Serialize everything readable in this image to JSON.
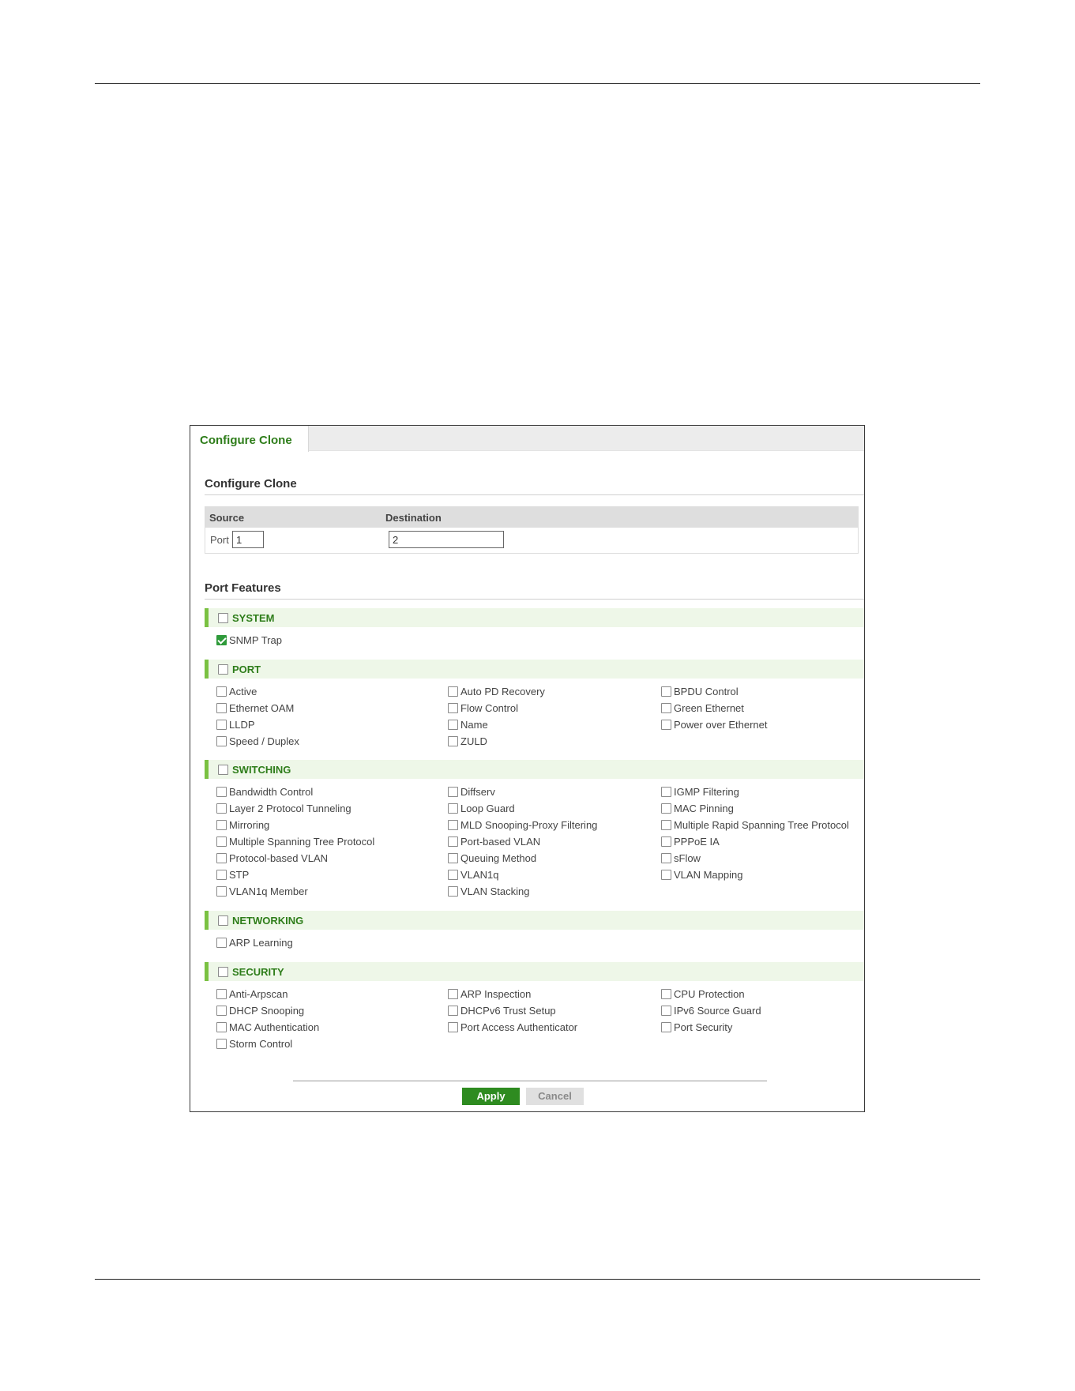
{
  "tab": {
    "label": "Configure Clone"
  },
  "section_title": "Configure Clone",
  "clone": {
    "source_header": "Source",
    "destination_header": "Destination",
    "port_label": "Port",
    "source_port": "1",
    "destination_port": "2"
  },
  "features_title": "Port Features",
  "categories": {
    "system": {
      "label": "SYSTEM",
      "checked": false,
      "items": [
        {
          "label": "SNMP Trap",
          "checked": true
        }
      ]
    },
    "port": {
      "label": "PORT",
      "checked": false,
      "items": [
        {
          "label": "Active"
        },
        {
          "label": "Auto PD Recovery"
        },
        {
          "label": "BPDU Control"
        },
        {
          "label": "Ethernet OAM"
        },
        {
          "label": "Flow Control"
        },
        {
          "label": "Green Ethernet"
        },
        {
          "label": "LLDP"
        },
        {
          "label": "Name"
        },
        {
          "label": "Power over Ethernet"
        },
        {
          "label": "Speed / Duplex"
        },
        {
          "label": "ZULD"
        }
      ]
    },
    "switching": {
      "label": "SWITCHING",
      "checked": false,
      "items": [
        {
          "label": "Bandwidth Control"
        },
        {
          "label": "Diffserv"
        },
        {
          "label": "IGMP Filtering"
        },
        {
          "label": "Layer 2 Protocol Tunneling"
        },
        {
          "label": "Loop Guard"
        },
        {
          "label": "MAC Pinning"
        },
        {
          "label": "Mirroring"
        },
        {
          "label": "MLD Snooping-Proxy Filtering"
        },
        {
          "label": "Multiple Rapid Spanning Tree Protocol"
        },
        {
          "label": "Multiple Spanning Tree Protocol"
        },
        {
          "label": "Port-based VLAN"
        },
        {
          "label": "PPPoE IA"
        },
        {
          "label": "Protocol-based VLAN"
        },
        {
          "label": "Queuing Method"
        },
        {
          "label": "sFlow"
        },
        {
          "label": "STP"
        },
        {
          "label": "VLAN1q"
        },
        {
          "label": "VLAN Mapping"
        },
        {
          "label": "VLAN1q Member"
        },
        {
          "label": "VLAN Stacking"
        }
      ]
    },
    "networking": {
      "label": "NETWORKING",
      "checked": false,
      "items": [
        {
          "label": "ARP Learning"
        }
      ]
    },
    "security": {
      "label": "SECURITY",
      "checked": false,
      "items": [
        {
          "label": "Anti-Arpscan"
        },
        {
          "label": "ARP Inspection"
        },
        {
          "label": "CPU Protection"
        },
        {
          "label": "DHCP Snooping"
        },
        {
          "label": "DHCPv6 Trust Setup"
        },
        {
          "label": "IPv6 Source Guard"
        },
        {
          "label": "MAC Authentication"
        },
        {
          "label": "Port Access Authenticator"
        },
        {
          "label": "Port Security"
        },
        {
          "label": "Storm Control"
        }
      ]
    }
  },
  "buttons": {
    "apply": "Apply",
    "cancel": "Cancel"
  },
  "colors": {
    "accent_green": "#2e7d1a",
    "bar_green": "#7ac142",
    "apply_bg": "#2e8b20"
  }
}
